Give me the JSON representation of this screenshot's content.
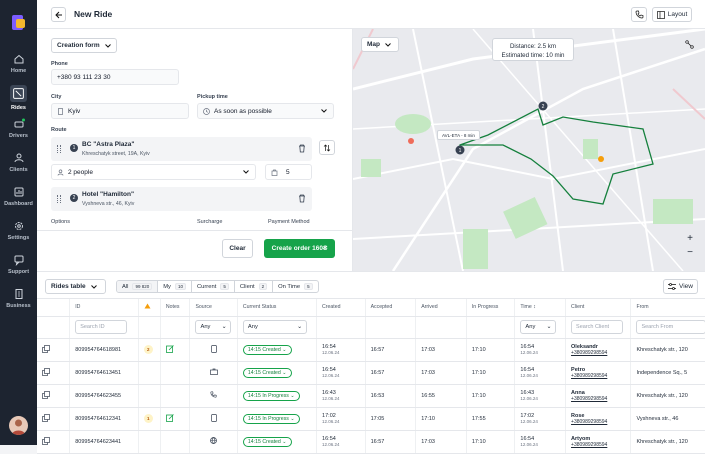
{
  "sidebar": {
    "items": [
      {
        "label": "Home"
      },
      {
        "label": "Rides"
      },
      {
        "label": "Drivers"
      },
      {
        "label": "Clients"
      },
      {
        "label": "Dashboard"
      },
      {
        "label": "Settings"
      },
      {
        "label": "Support"
      },
      {
        "label": "Business"
      }
    ]
  },
  "header": {
    "title": "New Ride",
    "layout_label": "Layout"
  },
  "form": {
    "mode": "Creation form",
    "phone_label": "Phone",
    "phone_value": "+380 93 111 23 30",
    "city_label": "City",
    "city_value": "Kyiv",
    "pickup_label": "Pickup time",
    "pickup_value": "As soon as possible",
    "route_label": "Route",
    "stops": [
      {
        "num": "1",
        "name": "BC \"Astra Plaza\"",
        "address": "Khreschatyk street, 19A, Kyiv"
      },
      {
        "num": "2",
        "name": "Hotel \"Hamilton\"",
        "address": "Vyshneva str., 46, Kyiv"
      }
    ],
    "people_value": "2 people",
    "luggage_value": "5",
    "options_label": "Options",
    "surcharge_label": "Surcharge",
    "payment_label": "Payment Method",
    "clear_label": "Clear",
    "create_label": "Create order 160₴"
  },
  "map": {
    "type_label": "Map",
    "distance_label": "Distance: 2.5 km",
    "time_label": "Estimated time: 10 min",
    "pin_label": "AVL-ETA - 8 min",
    "zoom_in": "+",
    "zoom_out": "−"
  },
  "table": {
    "title": "Rides table",
    "view_label": "View",
    "filters": [
      {
        "label": "All",
        "count": "99 820"
      },
      {
        "label": "My",
        "count": "10"
      },
      {
        "label": "Current",
        "count": "5"
      },
      {
        "label": "Client",
        "count": "2"
      },
      {
        "label": "On Time",
        "count": "5"
      }
    ],
    "columns": [
      "",
      "ID",
      "",
      "Notes",
      "Source",
      "Current Status",
      "Created",
      "Accepted",
      "Arrived",
      "In Progress",
      "Time",
      "Client",
      "From",
      "To"
    ],
    "search_id_placeholder": "Search ID",
    "any_label": "Any",
    "search_client_placeholder": "Search Client",
    "search_from_placeholder": "Search From",
    "search_to_placeholder": "Se",
    "rows": [
      {
        "id": "809954764618981",
        "badge": "2",
        "status": "14:15 Created",
        "created": "16:54",
        "created_date": "12.06.24",
        "accepted": "16:57",
        "arrived": "17:03",
        "progress": "17:10",
        "time": "16:54",
        "time_date": "12.06.24",
        "client": "Oleksandr",
        "phone": "+380989298594",
        "from": "Khreschatyk str., 120",
        "to": "Darn"
      },
      {
        "id": "809954764613451",
        "badge": "",
        "status": "14:15 Created",
        "created": "16:54",
        "created_date": "12.06.24",
        "accepted": "16:57",
        "arrived": "17:03",
        "progress": "17:10",
        "time": "16:54",
        "time_date": "12.06.24",
        "client": "Petro",
        "phone": "+380989298594",
        "from": "Independence Sq., 5",
        "to": "Volo"
      },
      {
        "id": "809954764623455",
        "badge": "",
        "status": "14:15 In Progress",
        "created": "16:43",
        "created_date": "12.06.24",
        "accepted": "16:53",
        "arrived": "16:55",
        "progress": "17:10",
        "time": "16:43",
        "time_date": "12.06.24",
        "client": "Anna",
        "phone": "+380989298594",
        "from": "Khreschatyk str., 120",
        "to": "Darn"
      },
      {
        "id": "809954764612341",
        "badge": "1",
        "status": "14:15 In Progress",
        "created": "17:02",
        "created_date": "12.06.24",
        "accepted": "17:05",
        "arrived": "17:10",
        "progress": "17:55",
        "time": "17:02",
        "time_date": "12.06.24",
        "client": "Rose",
        "phone": "+380989298594",
        "from": "Vyshneva str., 46",
        "to": "Darn"
      },
      {
        "id": "809954764623441",
        "badge": "",
        "status": "14:15 Created",
        "created": "16:54",
        "created_date": "12.06.24",
        "accepted": "16:57",
        "arrived": "17:03",
        "progress": "17:10",
        "time": "16:54",
        "time_date": "12.06.24",
        "client": "Artyom",
        "phone": "+380989298594",
        "from": "Khreschatyk str., 120",
        "to": "Darn"
      }
    ]
  }
}
